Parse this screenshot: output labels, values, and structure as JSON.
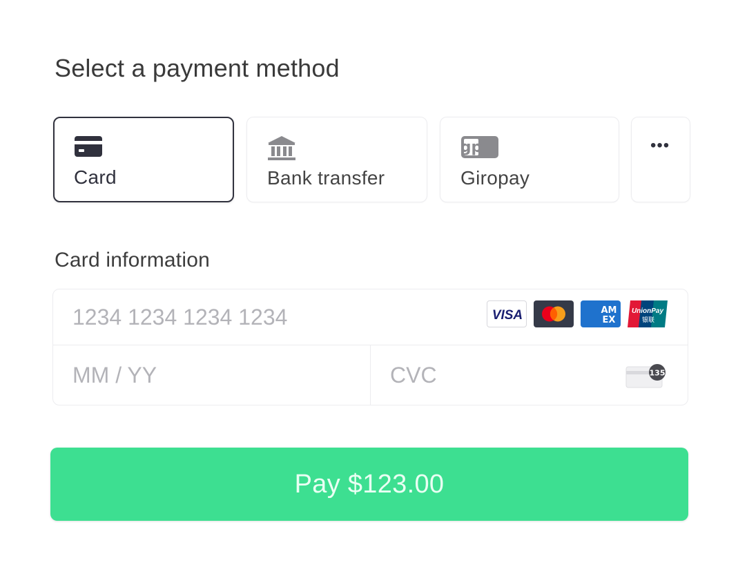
{
  "title": "Select a payment method",
  "methods": [
    {
      "label": "Card",
      "icon": "credit-card-icon",
      "selected": true
    },
    {
      "label": "Bank transfer",
      "icon": "bank-icon",
      "selected": false
    },
    {
      "label": "Giropay",
      "icon": "giropay-logo-icon",
      "selected": false
    },
    {
      "label": "",
      "icon": "more-icon",
      "selected": false
    }
  ],
  "more_glyph": "•••",
  "giropay_logo_text": "gp",
  "card_info": {
    "label": "Card information",
    "number_placeholder": "1234 1234 1234 1234",
    "expiry_placeholder": "MM / YY",
    "cvc_placeholder": "CVC",
    "cvc_badge": "135",
    "brands": [
      {
        "name": "VISA",
        "icon": "visa-icon",
        "color": "#1a1f71"
      },
      {
        "name": "Mastercard",
        "icon": "mastercard-icon",
        "color": "#353a48"
      },
      {
        "name": "AMEX",
        "icon": "amex-icon",
        "color": "#1f72cd"
      },
      {
        "name": "UnionPay",
        "icon": "unionpay-icon",
        "color": "#e21836"
      }
    ]
  },
  "pay_button": {
    "label": "Pay $123.00",
    "color": "#3ddf91"
  },
  "colors": {
    "selected_border": "#30313d",
    "border": "#ececef",
    "placeholder": "#b3b3b8"
  }
}
